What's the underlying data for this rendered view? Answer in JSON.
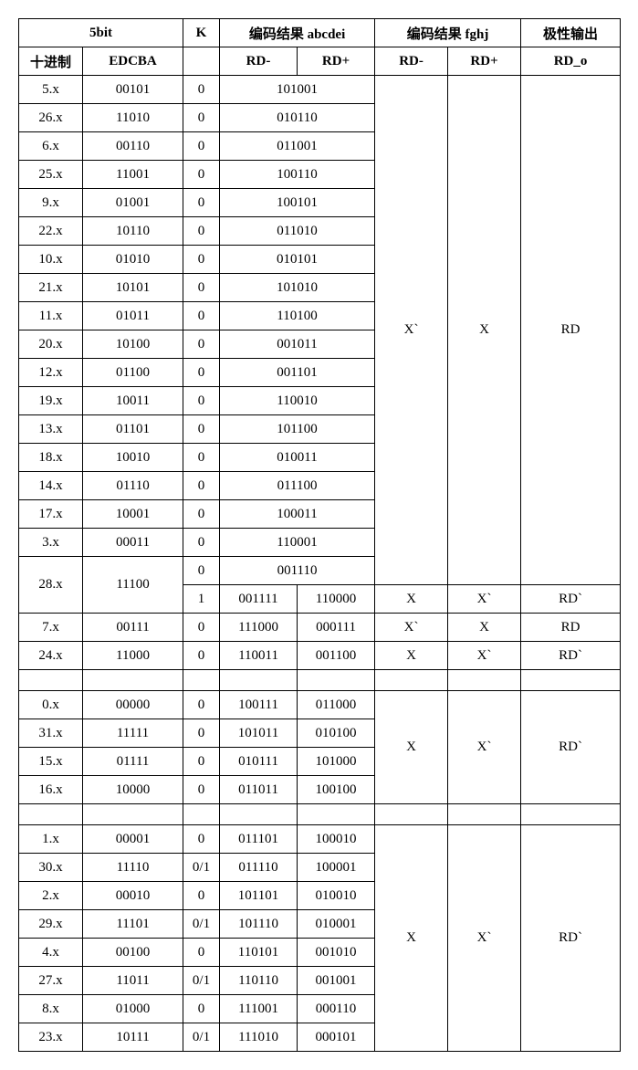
{
  "headers": {
    "h_5bit": "5bit",
    "h_k": "K",
    "h_abcdei": "编码结果 abcdei",
    "h_fghj": "编码结果 fghj",
    "h_polarity": "极性输出",
    "h_dec": "十进制",
    "h_edcba": "EDCBA",
    "h_rdm": "RD-",
    "h_rdp": "RD+",
    "h_rdo": "RD_o"
  },
  "chart_data": {
    "type": "table",
    "groups": [
      {
        "fghj_rdm": "X`",
        "fghj_rdp": "X",
        "rdo": "RD",
        "rows": [
          {
            "dec": "5.x",
            "edcba": "00101",
            "k": "0",
            "abcdei": "101001"
          },
          {
            "dec": "26.x",
            "edcba": "11010",
            "k": "0",
            "abcdei": "010110"
          },
          {
            "dec": "6.x",
            "edcba": "00110",
            "k": "0",
            "abcdei": "011001"
          },
          {
            "dec": "25.x",
            "edcba": "11001",
            "k": "0",
            "abcdei": "100110"
          },
          {
            "dec": "9.x",
            "edcba": "01001",
            "k": "0",
            "abcdei": "100101"
          },
          {
            "dec": "22.x",
            "edcba": "10110",
            "k": "0",
            "abcdei": "011010"
          },
          {
            "dec": "10.x",
            "edcba": "01010",
            "k": "0",
            "abcdei": "010101"
          },
          {
            "dec": "21.x",
            "edcba": "10101",
            "k": "0",
            "abcdei": "101010"
          },
          {
            "dec": "11.x",
            "edcba": "01011",
            "k": "0",
            "abcdei": "110100"
          },
          {
            "dec": "20.x",
            "edcba": "10100",
            "k": "0",
            "abcdei": "001011"
          },
          {
            "dec": "12.x",
            "edcba": "01100",
            "k": "0",
            "abcdei": "001101"
          },
          {
            "dec": "19.x",
            "edcba": "10011",
            "k": "0",
            "abcdei": "110010"
          },
          {
            "dec": "13.x",
            "edcba": "01101",
            "k": "0",
            "abcdei": "101100"
          },
          {
            "dec": "18.x",
            "edcba": "10010",
            "k": "0",
            "abcdei": "010011"
          },
          {
            "dec": "14.x",
            "edcba": "01110",
            "k": "0",
            "abcdei": "011100"
          },
          {
            "dec": "17.x",
            "edcba": "10001",
            "k": "0",
            "abcdei": "100011"
          },
          {
            "dec": "3.x",
            "edcba": "00011",
            "k": "0",
            "abcdei": "110001"
          },
          {
            "dec": "28.x",
            "edcba": "11100",
            "k": "0",
            "abcdei": "001110",
            "dec_rowspan": 2,
            "edcba_rowspan": 2
          }
        ]
      }
    ],
    "row_28k1": {
      "k": "1",
      "rdm": "001111",
      "rdp": "110000",
      "fgm": "X",
      "fgp": "X`",
      "rdo": "RD`"
    },
    "row_7": {
      "dec": "7.x",
      "edcba": "00111",
      "k": "0",
      "rdm": "111000",
      "rdp": "000111",
      "fgm": "X`",
      "fgp": "X",
      "rdo": "RD"
    },
    "row_24": {
      "dec": "24.x",
      "edcba": "11000",
      "k": "0",
      "rdm": "110011",
      "rdp": "001100",
      "fgm": "X",
      "fgp": "X`",
      "rdo": "RD`"
    },
    "group2": {
      "fghj_rdm": "X",
      "fghj_rdp": "X`",
      "rdo": "RD`",
      "rows": [
        {
          "dec": "0.x",
          "edcba": "00000",
          "k": "0",
          "rdm": "100111",
          "rdp": "011000"
        },
        {
          "dec": "31.x",
          "edcba": "11111",
          "k": "0",
          "rdm": "101011",
          "rdp": "010100"
        },
        {
          "dec": "15.x",
          "edcba": "01111",
          "k": "0",
          "rdm": "010111",
          "rdp": "101000"
        },
        {
          "dec": "16.x",
          "edcba": "10000",
          "k": "0",
          "rdm": "011011",
          "rdp": "100100"
        }
      ]
    },
    "group3": {
      "fghj_rdm": "X",
      "fghj_rdp": "X`",
      "rdo": "RD`",
      "rows": [
        {
          "dec": "1.x",
          "edcba": "00001",
          "k": "0",
          "rdm": "011101",
          "rdp": "100010"
        },
        {
          "dec": "30.x",
          "edcba": "11110",
          "k": "0/1",
          "rdm": "011110",
          "rdp": "100001"
        },
        {
          "dec": "2.x",
          "edcba": "00010",
          "k": "0",
          "rdm": "101101",
          "rdp": "010010"
        },
        {
          "dec": "29.x",
          "edcba": "11101",
          "k": "0/1",
          "rdm": "101110",
          "rdp": "010001"
        },
        {
          "dec": "4.x",
          "edcba": "00100",
          "k": "0",
          "rdm": "110101",
          "rdp": "001010"
        },
        {
          "dec": "27.x",
          "edcba": "11011",
          "k": "0/1",
          "rdm": "110110",
          "rdp": "001001"
        },
        {
          "dec": "8.x",
          "edcba": "01000",
          "k": "0",
          "rdm": "111001",
          "rdp": "000110"
        },
        {
          "dec": "23.x",
          "edcba": "10111",
          "k": "0/1",
          "rdm": "111010",
          "rdp": "000101"
        }
      ]
    }
  }
}
